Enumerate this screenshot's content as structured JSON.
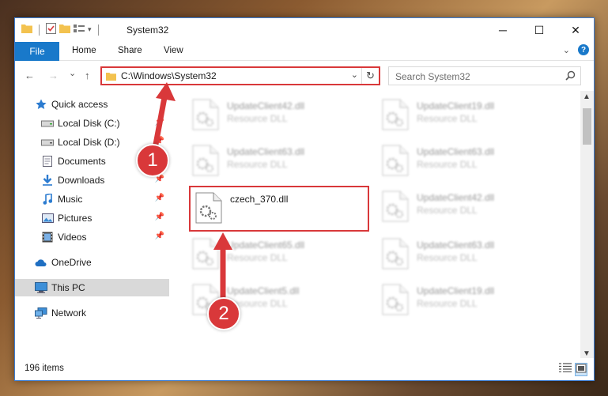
{
  "window": {
    "title": "System32"
  },
  "window_controls": {
    "minimize": "─",
    "maximize": "☐",
    "close": "✕"
  },
  "ribbon": {
    "tabs": [
      "File",
      "Home",
      "Share",
      "View"
    ]
  },
  "nav": {
    "back": "←",
    "forward": "→",
    "recent": "⌄",
    "up": "↑",
    "address": "C:\\Windows\\System32",
    "address_dropdown": "⌄",
    "refresh": "↻",
    "search_placeholder": "Search System32"
  },
  "sidebar": {
    "items": [
      {
        "label": "Quick access",
        "icon": "star-icon",
        "pinned": false
      },
      {
        "label": "Local Disk (C:)",
        "icon": "drive-icon",
        "pinned": true
      },
      {
        "label": "Local Disk (D:)",
        "icon": "drive-icon",
        "pinned": true
      },
      {
        "label": "Documents",
        "icon": "documents-icon",
        "pinned": true
      },
      {
        "label": "Downloads",
        "icon": "download-icon",
        "pinned": true
      },
      {
        "label": "Music",
        "icon": "music-icon",
        "pinned": true
      },
      {
        "label": "Pictures",
        "icon": "pictures-icon",
        "pinned": true
      },
      {
        "label": "Videos",
        "icon": "videos-icon",
        "pinned": true
      },
      {
        "label": "OneDrive",
        "icon": "cloud-icon",
        "pinned": false
      },
      {
        "label": "This PC",
        "icon": "computer-icon",
        "pinned": false,
        "selected": true
      },
      {
        "label": "Network",
        "icon": "network-icon",
        "pinned": false
      }
    ]
  },
  "files": [
    {
      "name": "UpdateClient42.dll",
      "type": "Resource DLL"
    },
    {
      "name": "UpdateClient19.dll",
      "type": "Resource DLL"
    },
    {
      "name": "UpdateClient63.dll",
      "type": "Resource DLL"
    },
    {
      "name": "UpdateClient63.dll",
      "type": "Resource DLL"
    },
    {
      "name": "czech_370.dll",
      "type": ""
    },
    {
      "name": "UpdateClient42.dll",
      "type": "Resource DLL"
    },
    {
      "name": "UpdateClient65.dll",
      "type": "Resource DLL"
    },
    {
      "name": "UpdateClient63.dll",
      "type": "Resource DLL"
    },
    {
      "name": "UpdateClient5.dll",
      "type": "Resource DLL"
    },
    {
      "name": "UpdateClient19.dll",
      "type": "Resource DLL"
    }
  ],
  "status": {
    "item_count": "196 items"
  },
  "callouts": {
    "one": "1",
    "two": "2"
  },
  "colors": {
    "accent": "#1979ca",
    "highlight": "#d9383a",
    "selected": "#d9d9d9"
  }
}
